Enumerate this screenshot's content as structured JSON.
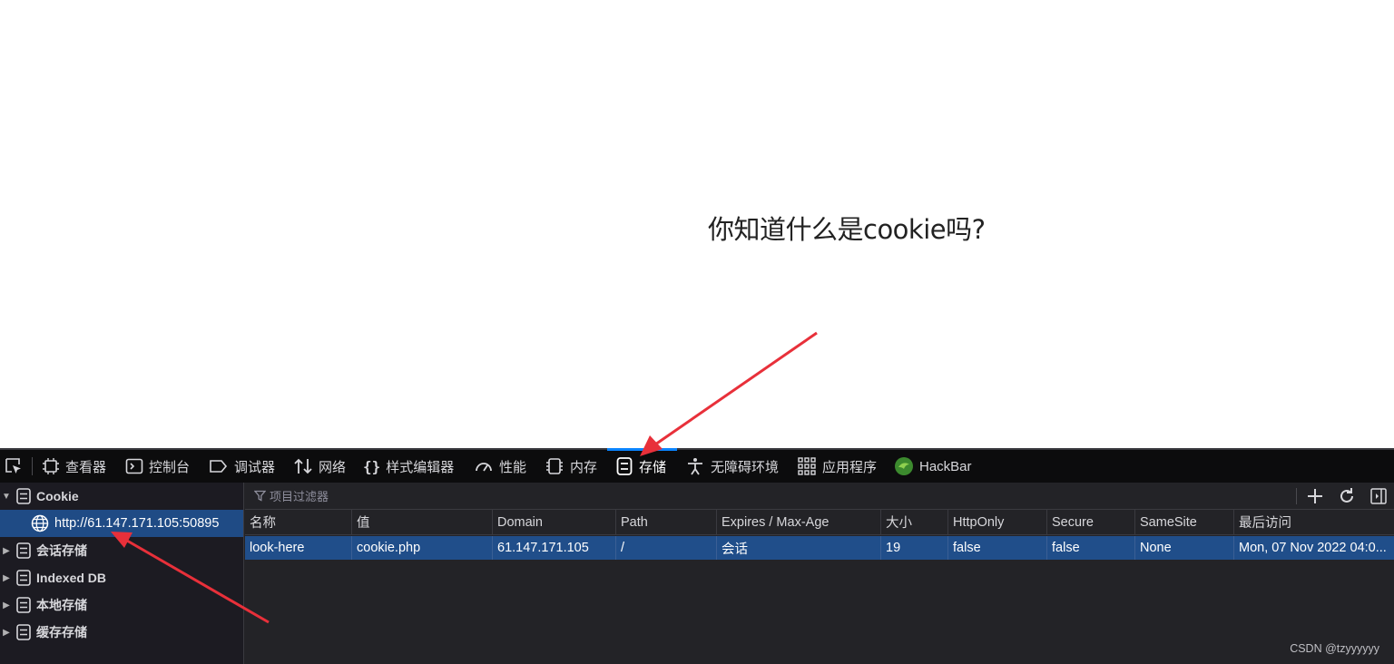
{
  "page": {
    "heading": "你知道什么是cookie吗?"
  },
  "toolbar": {
    "tools": [
      {
        "label": "查看器",
        "icon": "inspector-icon"
      },
      {
        "label": "控制台",
        "icon": "console-icon"
      },
      {
        "label": "调试器",
        "icon": "debugger-icon"
      },
      {
        "label": "网络",
        "icon": "network-icon"
      },
      {
        "label": "样式编辑器",
        "icon": "style-editor-icon"
      },
      {
        "label": "性能",
        "icon": "performance-icon"
      },
      {
        "label": "内存",
        "icon": "memory-icon"
      },
      {
        "label": "存储",
        "icon": "storage-icon",
        "active": true
      },
      {
        "label": "无障碍环境",
        "icon": "accessibility-icon"
      },
      {
        "label": "应用程序",
        "icon": "application-icon"
      },
      {
        "label": "HackBar",
        "icon": "hackbar-icon"
      }
    ]
  },
  "sidebar": {
    "items": [
      {
        "label": "Cookie",
        "expanded": true
      },
      {
        "label": "http://61.147.171.105:50895",
        "selected": true
      },
      {
        "label": "会话存储"
      },
      {
        "label": "Indexed DB"
      },
      {
        "label": "本地存储"
      },
      {
        "label": "缓存存储"
      }
    ]
  },
  "filter": {
    "placeholder": "项目过滤器"
  },
  "table": {
    "columns": [
      "名称",
      "值",
      "Domain",
      "Path",
      "Expires / Max-Age",
      "大小",
      "HttpOnly",
      "Secure",
      "SameSite",
      "最后访问"
    ],
    "rows": [
      [
        "look-here",
        "cookie.php",
        "61.147.171.105",
        "/",
        "会话",
        "19",
        "false",
        "false",
        "None",
        "Mon, 07 Nov 2022 04:0..."
      ]
    ]
  },
  "watermark": "CSDN @tzyyyyyy",
  "colors": {
    "accent": "#0a84ff",
    "selection": "#204e8a",
    "arrow": "#e8303a"
  }
}
